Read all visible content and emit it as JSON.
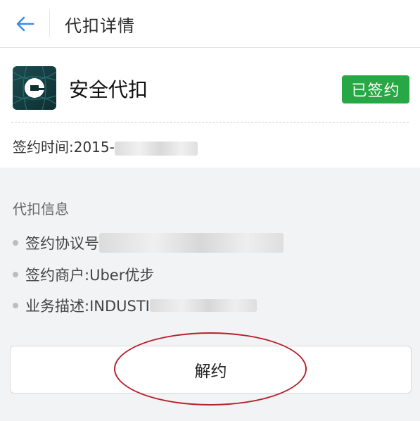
{
  "header": {
    "title": "代扣详情",
    "back_icon": "back-arrow-icon"
  },
  "colors": {
    "accent": "#3a8ee6",
    "badge_green": "#27a844",
    "annotation_red": "#b7202a"
  },
  "service": {
    "name": "安全代扣",
    "status_badge": "已签约",
    "logo_icon": "uber-logo-icon",
    "sign_time_label": "签约时间:2015-"
  },
  "details": {
    "section_title": "代扣信息",
    "items": [
      {
        "label": "签约协议号"
      },
      {
        "label": "签约商户:Uber优步"
      },
      {
        "label": "业务描述:INDUSTI"
      }
    ]
  },
  "actions": {
    "unsign_label": "解约"
  }
}
